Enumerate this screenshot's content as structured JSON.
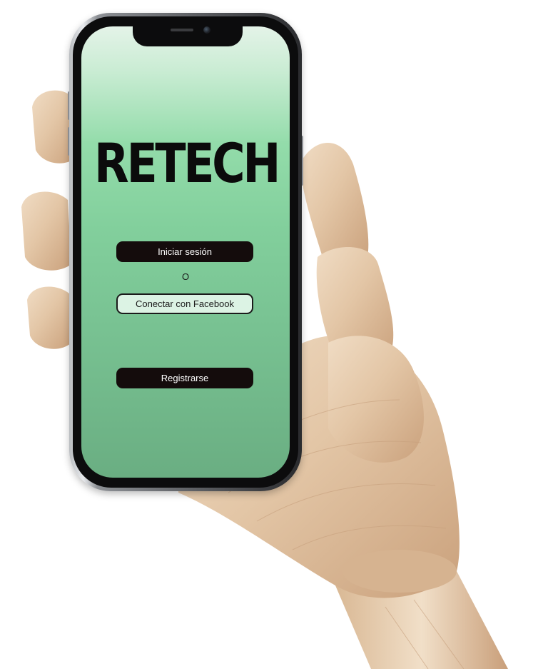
{
  "app": {
    "logo_text": "RETECH"
  },
  "login": {
    "signin_label": "Iniciar sesión",
    "separator": "O",
    "facebook_label": "Conectar con Facebook",
    "register_label": "Registrarse"
  },
  "colors": {
    "screen_gradient_top": "#e4f3e8",
    "screen_gradient_bottom": "#6aae82",
    "button_dark": "#140c0c",
    "button_light": "#dcf3e4",
    "hand_wood": "#e3c6a6"
  },
  "icons": {
    "decoration": "wooden-hand",
    "device": "smartphone"
  }
}
